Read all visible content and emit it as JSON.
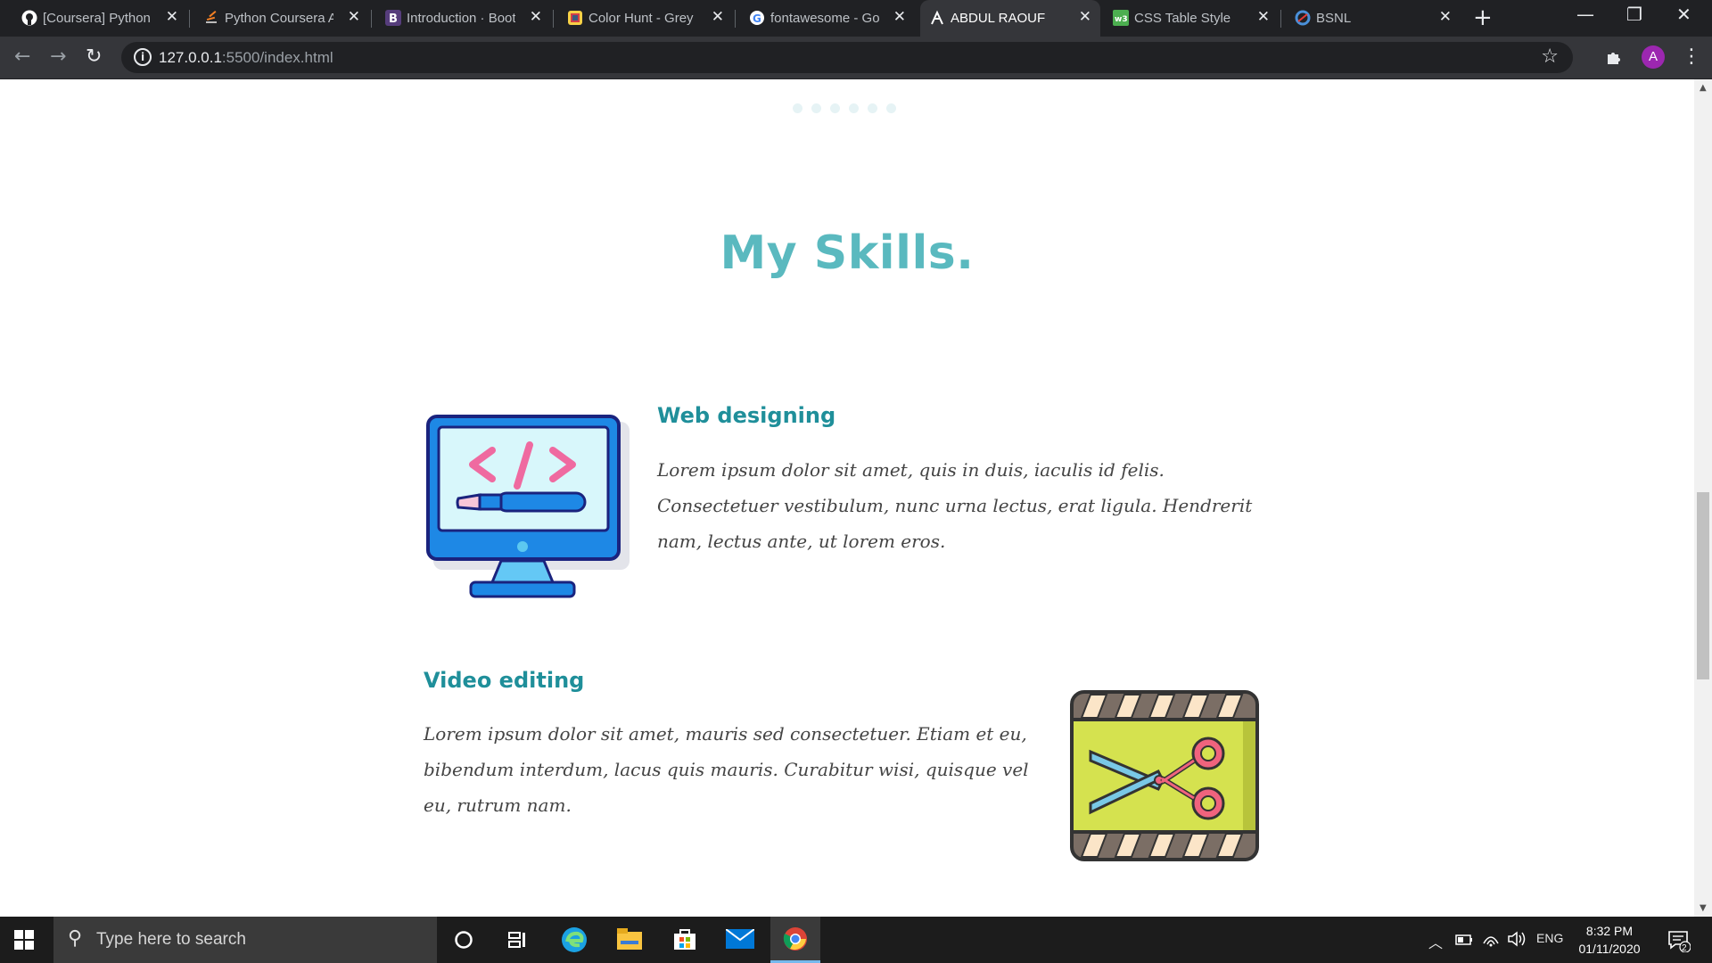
{
  "browser": {
    "tabs": [
      {
        "title": "[Coursera] Python",
        "icon": "github-icon",
        "active": false
      },
      {
        "title": "Python Coursera A",
        "icon": "stackoverflow-icon",
        "active": false
      },
      {
        "title": "Introduction · Boot",
        "icon": "bootstrap-icon",
        "active": false
      },
      {
        "title": "Color Hunt - Grey",
        "icon": "colorhunt-icon",
        "active": false
      },
      {
        "title": "fontawesome - Go",
        "icon": "google-icon",
        "active": false
      },
      {
        "title": "ABDUL RAOUF",
        "icon": "site-logo-icon",
        "active": true
      },
      {
        "title": "CSS Table Style",
        "icon": "w3schools-icon",
        "active": false
      },
      {
        "title": "BSNL",
        "icon": "bsnl-icon",
        "active": false
      }
    ],
    "url_host": "127.0.0.1",
    "url_path": ":5500/index.html",
    "profile_initial": "A"
  },
  "page": {
    "heading": "My Skills.",
    "carousel_dots": 6,
    "skills": [
      {
        "title": "Web designing",
        "text": "Lorem ipsum dolor sit amet, quis in duis, iaculis id felis. Consectetuer vestibulum, nunc urna lectus, erat ligula. Hendrerit nam, lectus ante, ut lorem eros.",
        "image": "monitor-code-icon"
      },
      {
        "title": "Video editing",
        "text": "Lorem ipsum dolor sit amet, mauris sed consectetuer. Etiam et eu, bibendum interdum, lacus quis mauris. Curabitur wisi, quisque vel eu, rutrum nam.",
        "image": "film-scissors-icon"
      }
    ]
  },
  "taskbar": {
    "search_placeholder": "Type here to search",
    "language": "ENG",
    "time": "8:32 PM",
    "date": "01/11/2020",
    "notification_count": "2"
  },
  "colors": {
    "heading": "#5ab9bf",
    "skill_title": "#1f8f9a",
    "body_text": "#444444"
  }
}
